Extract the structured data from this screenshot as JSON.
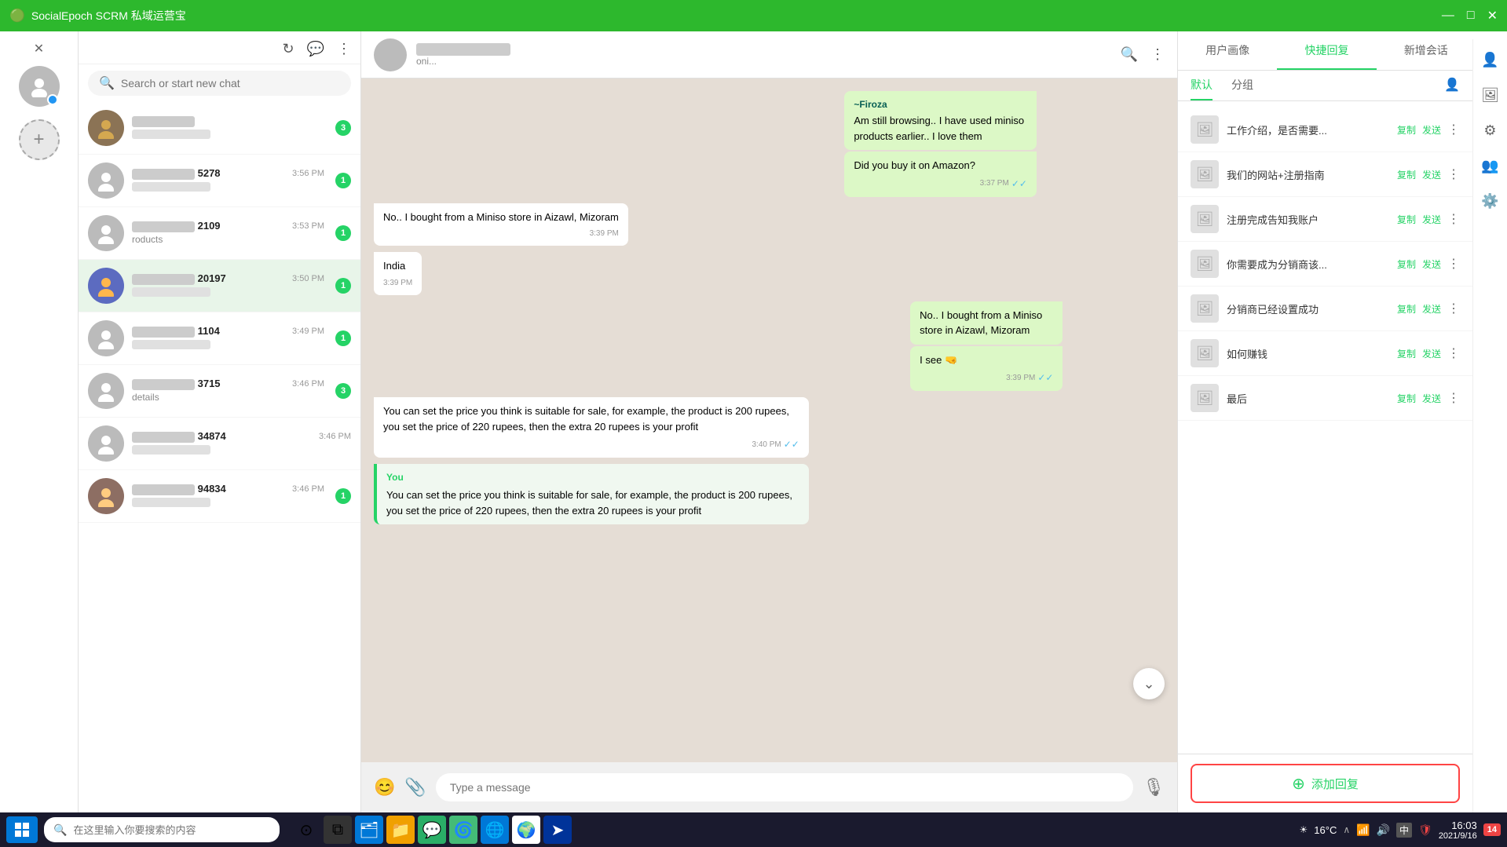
{
  "titleBar": {
    "appName": "SocialEpoch SCRM 私域运营宝",
    "minimize": "—",
    "maximize": "□",
    "close": "✕"
  },
  "chatList": {
    "searchPlaceholder": "Search or start new chat",
    "items": [
      {
        "id": 1,
        "name": "XXXXXXX",
        "preview": "",
        "time": "",
        "badge": 3,
        "hasPhoto": true
      },
      {
        "id": 2,
        "nameSuffix": "5278",
        "preview": "",
        "time": "3:56 PM",
        "badge": 1
      },
      {
        "id": 3,
        "nameSuffix": "2109",
        "preview": "roducts",
        "time": "3:53 PM",
        "badge": 1
      },
      {
        "id": 4,
        "nameSuffix": "20197",
        "preview": "",
        "time": "3:50 PM",
        "badge": 1,
        "hasPhoto": true
      },
      {
        "id": 5,
        "nameSuffix": "1104",
        "preview": "",
        "time": "3:49 PM",
        "badge": 1
      },
      {
        "id": 6,
        "nameSuffix": "3715",
        "preview": "details",
        "time": "3:46 PM",
        "badge": 3
      },
      {
        "id": 7,
        "nameSuffix": "34874",
        "preview": "",
        "time": "3:46 PM",
        "badge": 0
      },
      {
        "id": 8,
        "nameSuffix": "94834",
        "preview": "",
        "time": "3:46 PM",
        "badge": 1,
        "hasPhoto": true
      }
    ]
  },
  "chatWindow": {
    "contactName": "██████ ██████",
    "contactStatus": "oni...",
    "messages": [
      {
        "id": 1,
        "type": "outgoing",
        "sender": null,
        "senderLabel": "~Firoza",
        "text": "Am still browsing.. I have used miniso products earlier.. I love them",
        "subtext": "Did you buy it on Amazon?",
        "time": "3:37 PM",
        "ticks": "✓✓"
      },
      {
        "id": 2,
        "type": "incoming",
        "text": "No.. I bought from a Miniso store in Aizawl, Mizoram",
        "time": "3:39 PM"
      },
      {
        "id": 3,
        "type": "incoming",
        "text": "India",
        "time": "3:39 PM"
      },
      {
        "id": 4,
        "type": "outgoing",
        "senderLabel": null,
        "text": "No.. I bought from a Miniso store in Aizawl, Mizoram",
        "subtext": "I see 🤜",
        "time": "3:39 PM",
        "ticks": "✓✓"
      },
      {
        "id": 5,
        "type": "incoming",
        "text": "You can set the price you think is suitable for sale, for example, the product is 200 rupees, you set the price of 220 rupees, then the extra 20 rupees is your profit",
        "time": "3:40 PM",
        "ticks": "✓✓"
      },
      {
        "id": 6,
        "type": "quoted",
        "sender": "You",
        "quotedText": "You can set the price you think is suitable for sale, for example, the product is 200 rupees, you set the price of 220 rupees, then the extra 20 rupees is your profit",
        "time": ""
      }
    ],
    "typingPlaceholder": "Type a message"
  },
  "rightPanel": {
    "tabs": [
      "用户画像",
      "快捷回复",
      "新增会话"
    ],
    "subTabs": [
      "默认",
      "分组"
    ],
    "activeTab": 1,
    "activeSubTab": 0,
    "quickReplies": [
      {
        "id": 1,
        "text": "工作介绍，是否需要...",
        "copy": "复制",
        "send": "发送"
      },
      {
        "id": 2,
        "text": "我们的网站+注册指南",
        "copy": "复制",
        "send": "发送"
      },
      {
        "id": 3,
        "text": "注册完成告知我账户",
        "copy": "复制",
        "send": "发送"
      },
      {
        "id": 4,
        "text": "你需要成为分销商该...",
        "copy": "复制",
        "send": "发送"
      },
      {
        "id": 5,
        "text": "分销商已经设置成功",
        "copy": "复制",
        "send": "发送"
      },
      {
        "id": 6,
        "text": "如何赚钱",
        "copy": "复制",
        "send": "发送"
      },
      {
        "id": 7,
        "text": "最后",
        "copy": "复制",
        "send": "发送"
      }
    ],
    "addReplyLabel": "添加回复",
    "addIcon": "+"
  },
  "taskbar": {
    "searchPlaceholder": "在这里输入你要搜索的内容",
    "time": "16:03",
    "date": "2021/9/16",
    "notificationCount": "14",
    "temperature": "16°C"
  }
}
